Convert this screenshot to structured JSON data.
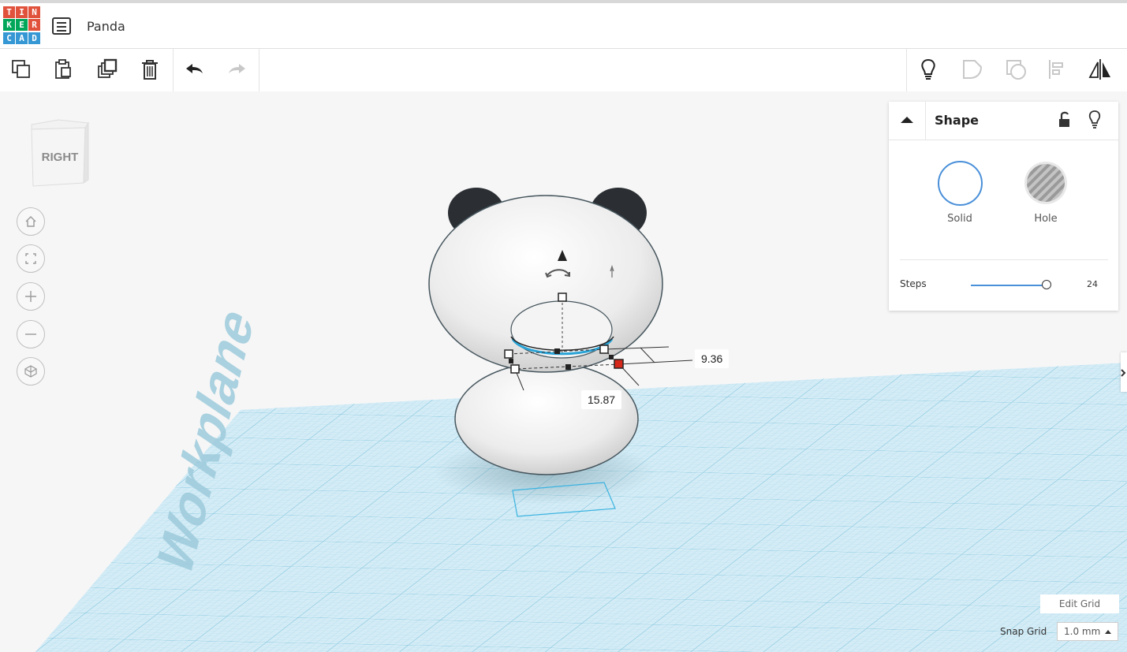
{
  "app": {
    "logo_letters": [
      "T",
      "I",
      "N",
      "K",
      "E",
      "R",
      "C",
      "A",
      "D"
    ],
    "logo_colors": [
      "#e1523d",
      "#e1523d",
      "#e1523d",
      "#00a65a",
      "#00a65a",
      "#e1523d",
      "#3597d3",
      "#3597d3",
      "#3597d3"
    ],
    "design_title": "Panda"
  },
  "toolbar": {
    "left_tools": [
      "copy-icon",
      "paste-icon",
      "duplicate-icon",
      "delete-icon",
      "undo-icon",
      "redo-icon"
    ],
    "right_tools": [
      "lightbulb-icon",
      "group-icon",
      "ungroup-icon",
      "align-icon",
      "mirror-icon"
    ]
  },
  "viewcube": {
    "face_label": "RIGHT"
  },
  "nav_buttons": [
    "home-view-icon",
    "fit-view-icon",
    "zoom-in-icon",
    "zoom-out-icon",
    "perspective-icon"
  ],
  "workplane": {
    "label": "Workplane",
    "grid_color": "#9fd3e6"
  },
  "dimensions": {
    "height_value": "9.36",
    "width_value": "15.87"
  },
  "shape_panel": {
    "title": "Shape",
    "solid_label": "Solid",
    "hole_label": "Hole",
    "solid_color": "#4a90d9",
    "steps_label": "Steps",
    "steps_value": "24",
    "steps_fraction": 1.0
  },
  "grid_controls": {
    "edit_grid_label": "Edit Grid",
    "snap_grid_label": "Snap Grid",
    "snap_value": "1.0 mm"
  }
}
